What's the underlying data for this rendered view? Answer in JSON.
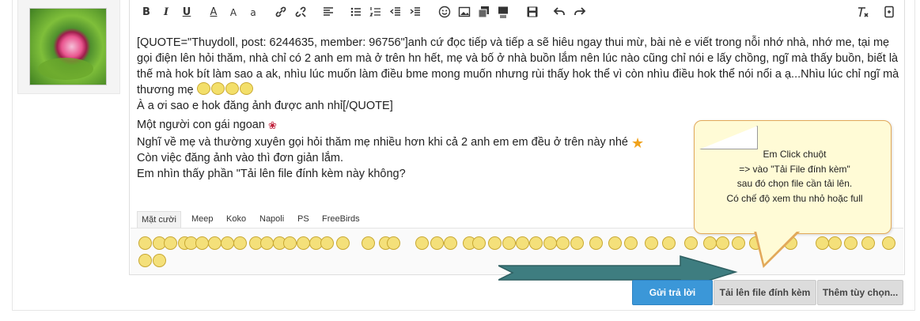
{
  "toolbar": {
    "bold": "B",
    "italic": "I",
    "underline": "U",
    "font_color": "A",
    "font_size": "A",
    "font_family": "a"
  },
  "post": {
    "lines": [
      "[QUOTE=\"Thuydoll, post: 6244635, member: 96756\"]anh cứ đọc tiếp và tiếp a sẽ hiêu ngay thui mừ, bài nè e viết trong nỗi nhớ nhà, nhớ me, tại mẹ gọi điện lên hỏi thăm, nhà chỉ có 2 anh em mà ở trên hn hết, mẹ và bố ở nhà buồn lắm nên lúc nào cũng chỉ nói e lấy chồng, ngĩ mà thấy buồn, biết là thế mà hok bít làm sao a ak, nhìu lúc muốn làm điều bme mong muốn nhưng rùi thấy hok thể vì còn nhìu điều hok thể nói nổi a ạ...Nhìu lúc chỉ ngĩ mà thương mẹ",
      "À a ơi sao e hok đăng ảnh được anh nhỉ[/QUOTE]",
      "Một người con gái ngoan",
      "Nghĩ về mẹ và thường xuyên gọi hỏi thăm mẹ nhiều hơn khi cả 2 anh em em đều ở trên này nhé",
      "Còn việc đăng ảnh vào thì đơn giản lắm.",
      "Em nhìn thấy phần \"Tải lên file đính kèm này không?"
    ]
  },
  "smiley_tabs": [
    "Mặt cười",
    "Meep",
    "Koko",
    "Napoli",
    "PS",
    "FreeBirds"
  ],
  "note": {
    "lines": [
      "Em Click chuột",
      "=> vào \"Tải File đính kèm\"",
      "sau đó chọn file cần tải lên.",
      "Có chế độ xem thu nhỏ hoặc full"
    ]
  },
  "buttons": {
    "reply": "Gửi trả lời",
    "upload": "Tải lên file đính kèm",
    "more": "Thêm tùy chọn..."
  },
  "colors": {
    "reply_button": "#3b97d8",
    "note_background": "#fffbd6",
    "note_border": "#e2a95a",
    "arrow": "#3e7d80"
  }
}
